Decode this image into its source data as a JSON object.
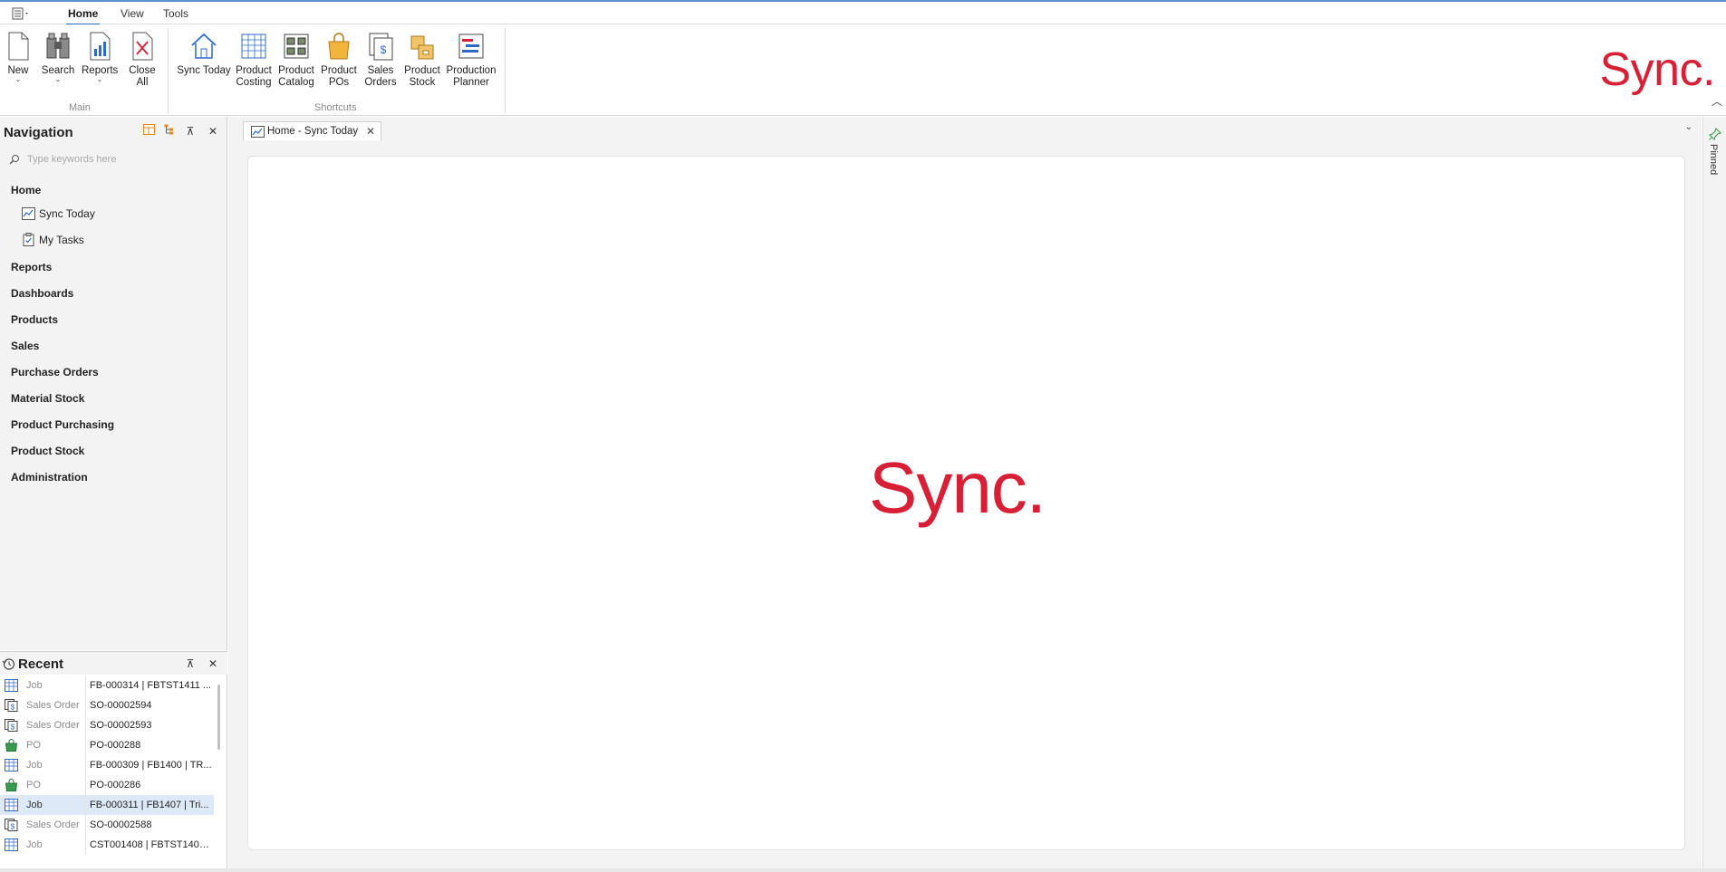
{
  "ribbon_tabs": [
    {
      "label": "Home",
      "active": true
    },
    {
      "label": "View",
      "active": false
    },
    {
      "label": "Tools",
      "active": false
    }
  ],
  "ribbon": {
    "main_group": {
      "label": "Main",
      "buttons": [
        {
          "line1": "New",
          "line2": "",
          "dropdown": true,
          "icon": "new-document-icon"
        },
        {
          "line1": "Search",
          "line2": "",
          "dropdown": true,
          "icon": "binoculars-icon"
        },
        {
          "line1": "Reports",
          "line2": "",
          "dropdown": true,
          "icon": "report-icon"
        },
        {
          "line1": "Close",
          "line2": "All",
          "dropdown": false,
          "icon": "close-all-icon"
        }
      ]
    },
    "shortcuts_group": {
      "label": "Shortcuts",
      "buttons": [
        {
          "line1": "Sync Today",
          "line2": "",
          "icon": "house-icon"
        },
        {
          "line1": "Product",
          "line2": "Costing",
          "icon": "costing-grid-icon"
        },
        {
          "line1": "Product",
          "line2": "Catalog",
          "icon": "catalog-icon"
        },
        {
          "line1": "Product",
          "line2": "POs",
          "icon": "shopping-bag-icon"
        },
        {
          "line1": "Sales",
          "line2": "Orders",
          "icon": "sales-order-icon"
        },
        {
          "line1": "Product",
          "line2": "Stock",
          "icon": "boxes-icon"
        },
        {
          "line1": "Production",
          "line2": "Planner",
          "icon": "planner-icon"
        }
      ]
    },
    "brand_logo": "Sync."
  },
  "navigation": {
    "title": "Navigation",
    "search_placeholder": "Type keywords here",
    "home_group": "Home",
    "home_items": [
      {
        "label": "Sync Today",
        "icon": "chart-icon"
      },
      {
        "label": "My Tasks",
        "icon": "clipboard-icon"
      }
    ],
    "groups": [
      "Reports",
      "Dashboards",
      "Products",
      "Sales",
      "Purchase Orders",
      "Material Stock",
      "Product Purchasing",
      "Product Stock",
      "Administration"
    ]
  },
  "recent": {
    "title": "Recent",
    "items": [
      {
        "type": "Job",
        "name": "FB-000314 | FBTST1411 ...",
        "icon": "job-icon"
      },
      {
        "type": "Sales Order",
        "name": "SO-00002594",
        "icon": "sales-order-icon"
      },
      {
        "type": "Sales Order",
        "name": "SO-00002593",
        "icon": "sales-order-icon"
      },
      {
        "type": "PO",
        "name": "PO-000288",
        "icon": "po-bag-icon"
      },
      {
        "type": "Job",
        "name": "FB-000309 | FB1400 | TR...",
        "icon": "job-icon"
      },
      {
        "type": "PO",
        "name": "PO-000286",
        "icon": "po-bag-icon"
      },
      {
        "type": "Job",
        "name": "FB-000311 | FB1407 | Tri...",
        "icon": "job-icon",
        "selected": true
      },
      {
        "type": "Sales Order",
        "name": "SO-00002588",
        "icon": "sales-order-icon"
      },
      {
        "type": "Job",
        "name": "CST001408 | FBTST1408...",
        "icon": "job-icon"
      }
    ]
  },
  "document": {
    "tab_label": "Home - Sync Today",
    "logo": "Sync."
  },
  "pinned_label": "Pinned",
  "colors": {
    "brand_red": "#d71f36",
    "accent_blue": "#2e6bc6"
  }
}
